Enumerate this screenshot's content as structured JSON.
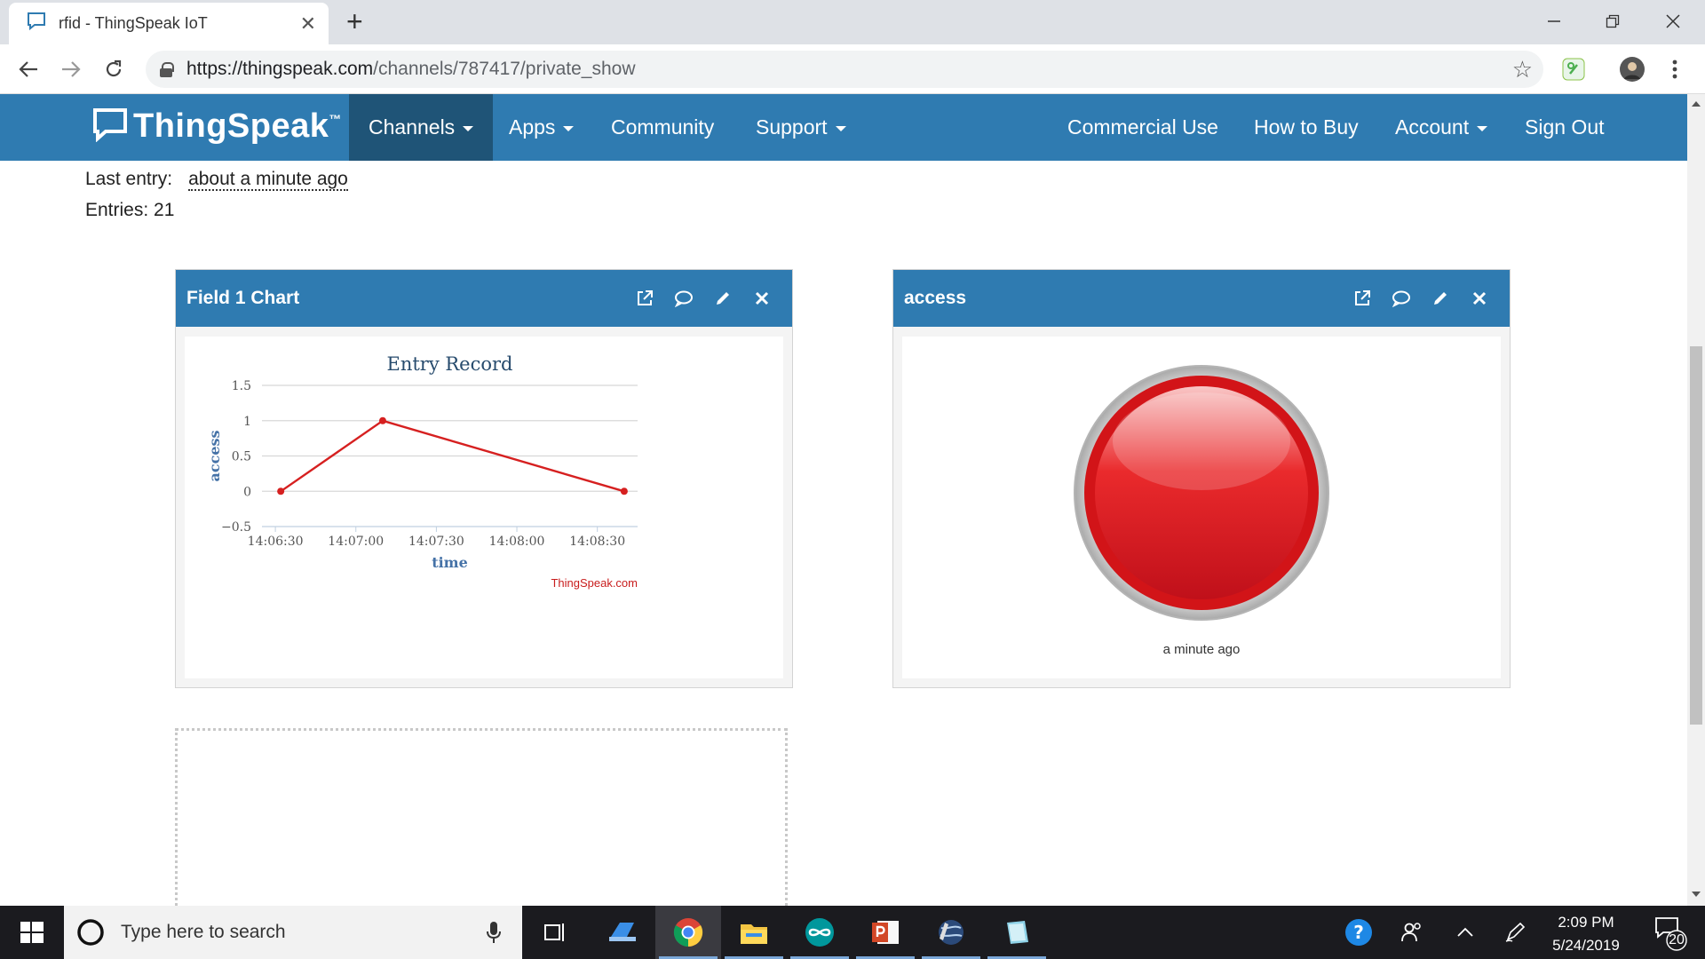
{
  "browser": {
    "tab_title": "rfid - ThingSpeak IoT",
    "url_host": "https://thingspeak.com",
    "url_path": "/channels/787417/private_show"
  },
  "nav": {
    "logo": "ThingSpeak",
    "logo_tm": "™",
    "items": [
      "Channels",
      "Apps",
      "Community",
      "Support",
      "Commercial Use",
      "How to Buy",
      "Account",
      "Sign Out"
    ]
  },
  "channel": {
    "last_entry_label": "Last entry:",
    "last_entry_value": "about a minute ago",
    "entries": "Entries: 21"
  },
  "widgets": [
    {
      "title": "Field 1 Chart"
    },
    {
      "title": "access",
      "caption": "a minute ago",
      "color": "#e8171b"
    }
  ],
  "chart_data": {
    "type": "line",
    "title": "Entry Record",
    "xlabel": "time",
    "ylabel": "access",
    "credit": "ThingSpeak.com",
    "x": [
      "14:06:32",
      "14:07:10",
      "14:08:40"
    ],
    "y": [
      0,
      1,
      0
    ],
    "x_ticks": [
      "14:06:30",
      "14:07:00",
      "14:07:30",
      "14:08:00",
      "14:08:30"
    ],
    "y_ticks": [
      "1.5",
      "1",
      "0.5",
      "0",
      "−0.5"
    ],
    "ylim": [
      -0.5,
      1.5
    ],
    "series_color": "#d62020",
    "grid": true
  },
  "taskbar": {
    "search_placeholder": "Type here to search",
    "time": "2:09 PM",
    "date": "5/24/2019",
    "notifications": "20"
  }
}
